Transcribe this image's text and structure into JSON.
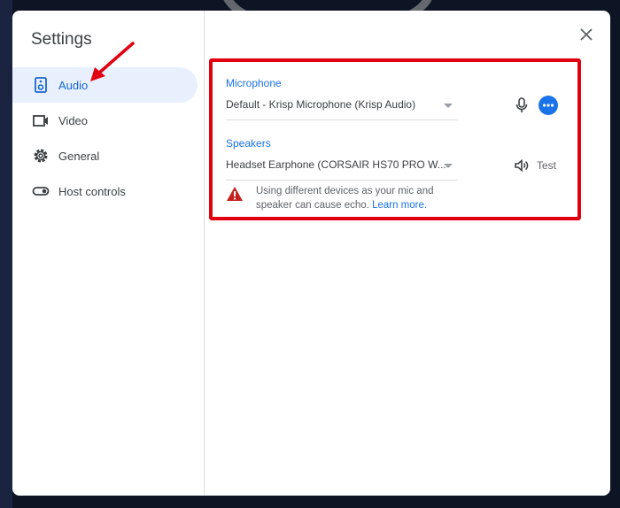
{
  "dialog": {
    "title": "Settings"
  },
  "sidebar": {
    "items": [
      {
        "label": "Audio",
        "icon": "speaker-icon",
        "active": true
      },
      {
        "label": "Video",
        "icon": "video-icon"
      },
      {
        "label": "General",
        "icon": "gear-icon"
      },
      {
        "label": "Host controls",
        "icon": "toggle-icon"
      }
    ]
  },
  "audio": {
    "microphone_label": "Microphone",
    "microphone_value": "Default - Krisp Microphone (Krisp Audio)",
    "speakers_label": "Speakers",
    "speakers_value": "Headset Earphone (CORSAIR HS70 PRO W...",
    "test_label": "Test",
    "warning_text": "Using different devices as your mic and speaker can cause echo.",
    "learn_more": "Learn more."
  },
  "colors": {
    "accent": "#1a73e8",
    "highlight": "#e00010"
  }
}
